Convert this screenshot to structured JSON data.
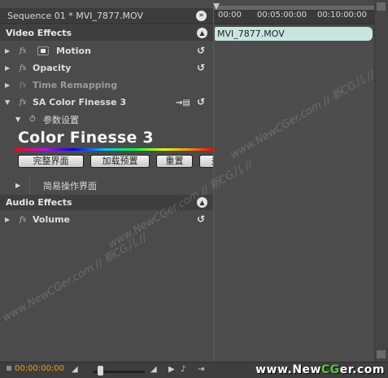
{
  "sequence": {
    "title": "Sequence 01 * MVI_7877.MOV"
  },
  "video_effects": {
    "header": "Video Effects",
    "effects": [
      {
        "name": "Motion",
        "fx": "fx"
      },
      {
        "name": "Opacity",
        "fx": "fx"
      },
      {
        "name": "Time Remapping",
        "fx": "fx"
      },
      {
        "name": "SA Color Finesse 3",
        "fx": "fx"
      }
    ],
    "param_group": "参数设置",
    "plugin_title": "Color Finesse 3",
    "buttons": [
      "完整界面",
      "加载预置",
      "重置",
      "关"
    ],
    "simple_ui": "简易操作界面"
  },
  "audio_effects": {
    "header": "Audio Effects",
    "effects": [
      {
        "name": "Volume",
        "fx": "fx"
      }
    ]
  },
  "timeline": {
    "ticks": [
      "00:00",
      "00:05:00:00",
      "00:10:00:00"
    ],
    "clip_name": "MVI_7877.MOV",
    "playhead_color": "#dd2222",
    "clip_color": "#c9e5e0"
  },
  "footer": {
    "timecode": "00:00:00:00"
  },
  "watermark": {
    "text": "www.NewCGer.com // 新CG儿 //",
    "logo_pre": "www.",
    "logo_brand_a": "New",
    "logo_brand_b": "CG",
    "logo_brand_c": "er",
    "logo_post": ".com"
  }
}
